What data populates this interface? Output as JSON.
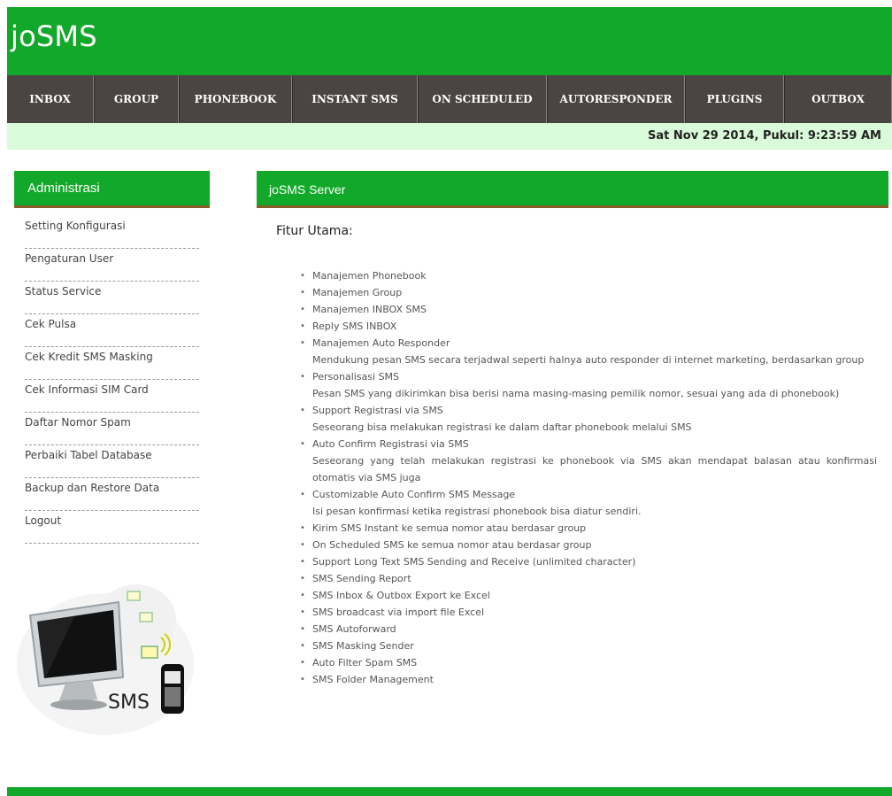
{
  "app": {
    "brand": "joSMS"
  },
  "nav": [
    {
      "label": "INBOX"
    },
    {
      "label": "GROUP"
    },
    {
      "label": "PHONEBOOK"
    },
    {
      "label": "INSTANT SMS"
    },
    {
      "label": "ON SCHEDULED"
    },
    {
      "label": "AUTORESPONDER"
    },
    {
      "label": "PLUGINS"
    },
    {
      "label": "OUTBOX"
    }
  ],
  "datebar": {
    "text": "Sat Nov 29 2014, Pukul: 9:23:59 AM"
  },
  "sidebar": {
    "title": "Administrasi",
    "items": [
      {
        "label": "Setting Konfigurasi"
      },
      {
        "label": "Pengaturan User"
      },
      {
        "label": "Status Service"
      },
      {
        "label": "Cek Pulsa"
      },
      {
        "label": "Cek Kredit SMS Masking"
      },
      {
        "label": "Cek Informasi SIM Card"
      },
      {
        "label": "Daftar Nomor Spam"
      },
      {
        "label": "Perbaiki Tabel Database"
      },
      {
        "label": "Backup dan Restore Data"
      },
      {
        "label": "Logout"
      }
    ],
    "image_label": "SMS"
  },
  "main": {
    "title": "joSMS Server",
    "subheading": "Fitur Utama:",
    "features": [
      {
        "label": "Manajemen Phonebook"
      },
      {
        "label": "Manajemen Group"
      },
      {
        "label": "Manajemen INBOX SMS"
      },
      {
        "label": "Reply SMS INBOX"
      },
      {
        "label": "Manajemen Auto Responder",
        "desc": "Mendukung pesan SMS secara terjadwal seperti halnya auto responder di internet marketing, berdasarkan group"
      },
      {
        "label": "Personalisasi SMS",
        "desc": "Pesan SMS yang dikirimkan bisa berisi nama masing-masing pemilik nomor, sesuai yang ada di phonebook)"
      },
      {
        "label": "Support Registrasi via SMS",
        "desc": "Seseorang bisa melakukan registrasi ke dalam daftar phonebook melalui SMS"
      },
      {
        "label": "Auto Confirm Registrasi via SMS",
        "desc": "Seseorang yang telah melakukan registrasi ke phonebook via SMS akan mendapat balasan atau konfirmasi otomatis via SMS juga"
      },
      {
        "label": "Customizable Auto Confirm SMS Message",
        "desc": "Isi pesan konfirmasi ketika registrasi phonebook bisa diatur sendiri."
      },
      {
        "label": "Kirim SMS Instant ke semua nomor atau berdasar group"
      },
      {
        "label": "On Scheduled SMS ke semua nomor atau berdasar group"
      },
      {
        "label": "Support Long Text SMS Sending and Receive (unlimited character)"
      },
      {
        "label": "SMS Sending Report"
      },
      {
        "label": "SMS Inbox & Outbox Export ke Excel"
      },
      {
        "label": "SMS broadcast via import file Excel"
      },
      {
        "label": "SMS Autoforward"
      },
      {
        "label": "SMS Masking Sender"
      },
      {
        "label": "Auto Filter Spam SMS"
      },
      {
        "label": "SMS Folder Management"
      }
    ]
  },
  "colors": {
    "brand_green": "#12a82a",
    "nav_bg": "#4a4442",
    "datebar_bg": "#d9fbd9",
    "title_underline": "#8a5c2a"
  }
}
